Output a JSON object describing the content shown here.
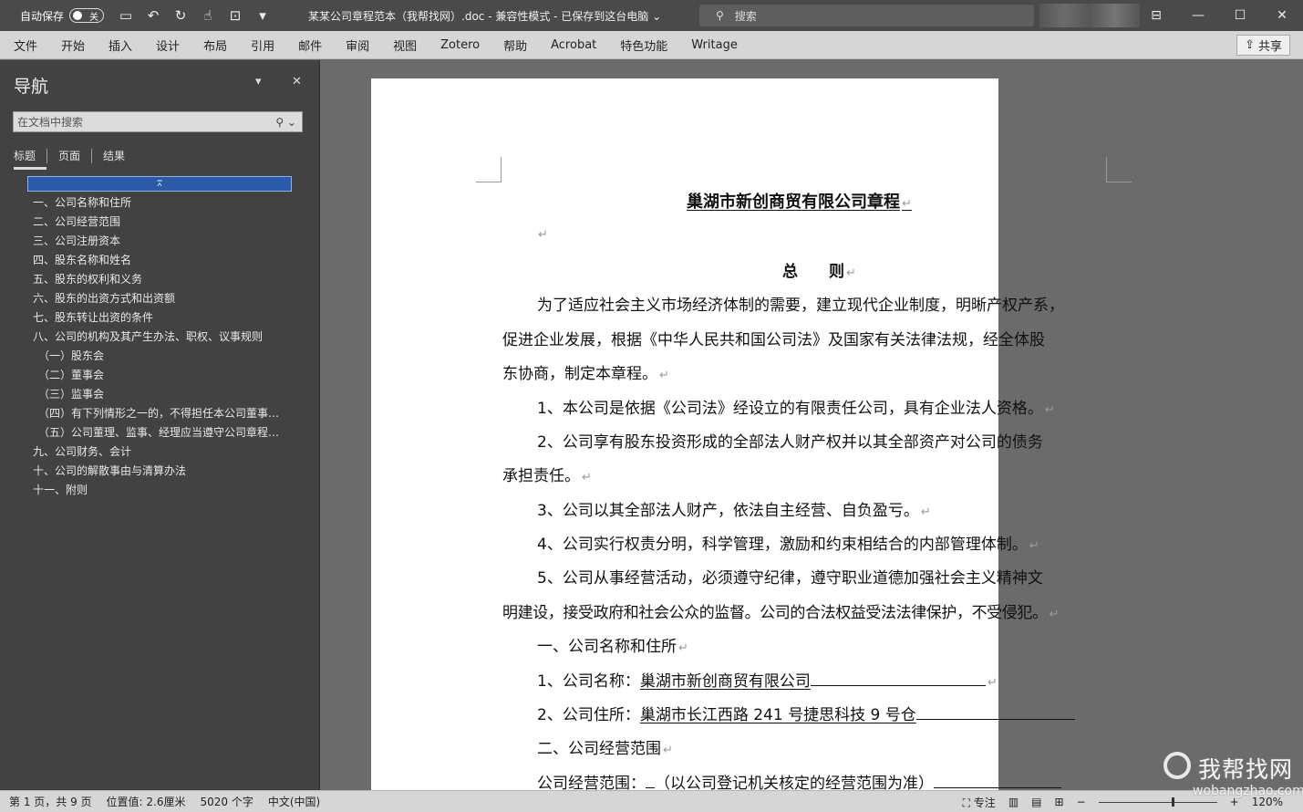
{
  "titlebar": {
    "autosave_label": "自动保存",
    "autosave_state": "关",
    "doc_title": "某某公司章程范本（我帮找网）.doc  -  兼容性模式 - 已保存到这台电脑 ⌄",
    "search_placeholder": "搜索"
  },
  "ribbon": {
    "tabs": [
      "文件",
      "开始",
      "插入",
      "设计",
      "布局",
      "引用",
      "邮件",
      "审阅",
      "视图",
      "Zotero",
      "帮助",
      "Acrobat",
      "特色功能",
      "Writage"
    ],
    "share_label": "共享"
  },
  "nav": {
    "title": "导航",
    "search_placeholder": "在文档中搜索",
    "tabs": [
      "标题",
      "页面",
      "结果"
    ],
    "items": [
      {
        "text": "一、公司名称和住所",
        "level": 1
      },
      {
        "text": "二、公司经营范围",
        "level": 1
      },
      {
        "text": "三、公司注册资本",
        "level": 1
      },
      {
        "text": "四、股东名称和姓名",
        "level": 1
      },
      {
        "text": "五、股东的权利和义务",
        "level": 1
      },
      {
        "text": "六、股东的出资方式和出资额",
        "level": 1
      },
      {
        "text": "七、股东转让出资的条件",
        "level": 1
      },
      {
        "text": "八、公司的机构及其产生办法、职权、议事规则",
        "level": 1
      },
      {
        "text": "（一）股东会",
        "level": 2
      },
      {
        "text": "（二）董事会",
        "level": 2
      },
      {
        "text": "（三）监事会",
        "level": 2
      },
      {
        "text": "（四）有下列情形之一的，不得担任本公司董事、...",
        "level": 2
      },
      {
        "text": "（五）公司董理、监事、经理应当遵守公司章程、...",
        "level": 2
      },
      {
        "text": "九、公司财务、会计",
        "level": 1
      },
      {
        "text": "十、公司的解散事由与清算办法",
        "level": 1
      },
      {
        "text": "十一、附则",
        "level": 1
      }
    ]
  },
  "document": {
    "title": "巢湖市新创商贸有限公司章程",
    "section_heading": "总　　则",
    "p1a": "为了适应社会主义市场经济体制的需要，建立现代企业制度，明晰产权产系，",
    "p1b": "促进企业发展，根据《中华人民共和国公司法》及国家有关法律法规，经全体股",
    "p1c": "东协商，制定本章程。",
    "p2": "1、本公司是依据《公司法》经设立的有限责任公司，具有企业法人资格。",
    "p3a": "2、公司享有股东投资形成的全部法人财产权并以其全部资产对公司的债务",
    "p3b": "承担责任。",
    "p4": "3、公司以其全部法人财产，依法自主经营、自负盈亏。",
    "p5": "4、公司实行权责分明，科学管理，激励和约束相结合的内部管理体制。",
    "p6a": "5、公司从事经营活动，必须遵守纪律，遵守职业道德加强社会主义精神文",
    "p6b": "明建设，接受政府和社会公众的监督。公司的合法权益受法法律保护，不受侵犯。",
    "h1": "一、公司名称和住所",
    "name_label": "1、公司名称：",
    "name_value": "巢湖市新创商贸有限公司",
    "addr_label": "2、公司住所：",
    "addr_value": "巢湖市长江西路 241 号捷思科技 9 号仓",
    "h2": "二、公司经营范围",
    "scope_label": "公司经营范围：",
    "scope_value": "（以公司登记机关核定的经营范围为准）",
    "para_mark": "↵"
  },
  "statusbar": {
    "page": "第 1 页，共 9 页",
    "position": "位置值: 2.6厘米",
    "words": "5020 个字",
    "language": "中文(中国)",
    "focus": "专注",
    "zoom": "120%",
    "zoom_fraction": 0.62
  },
  "watermark": {
    "text_cn": "我帮找网",
    "text_en": "wobangzhao.com"
  }
}
